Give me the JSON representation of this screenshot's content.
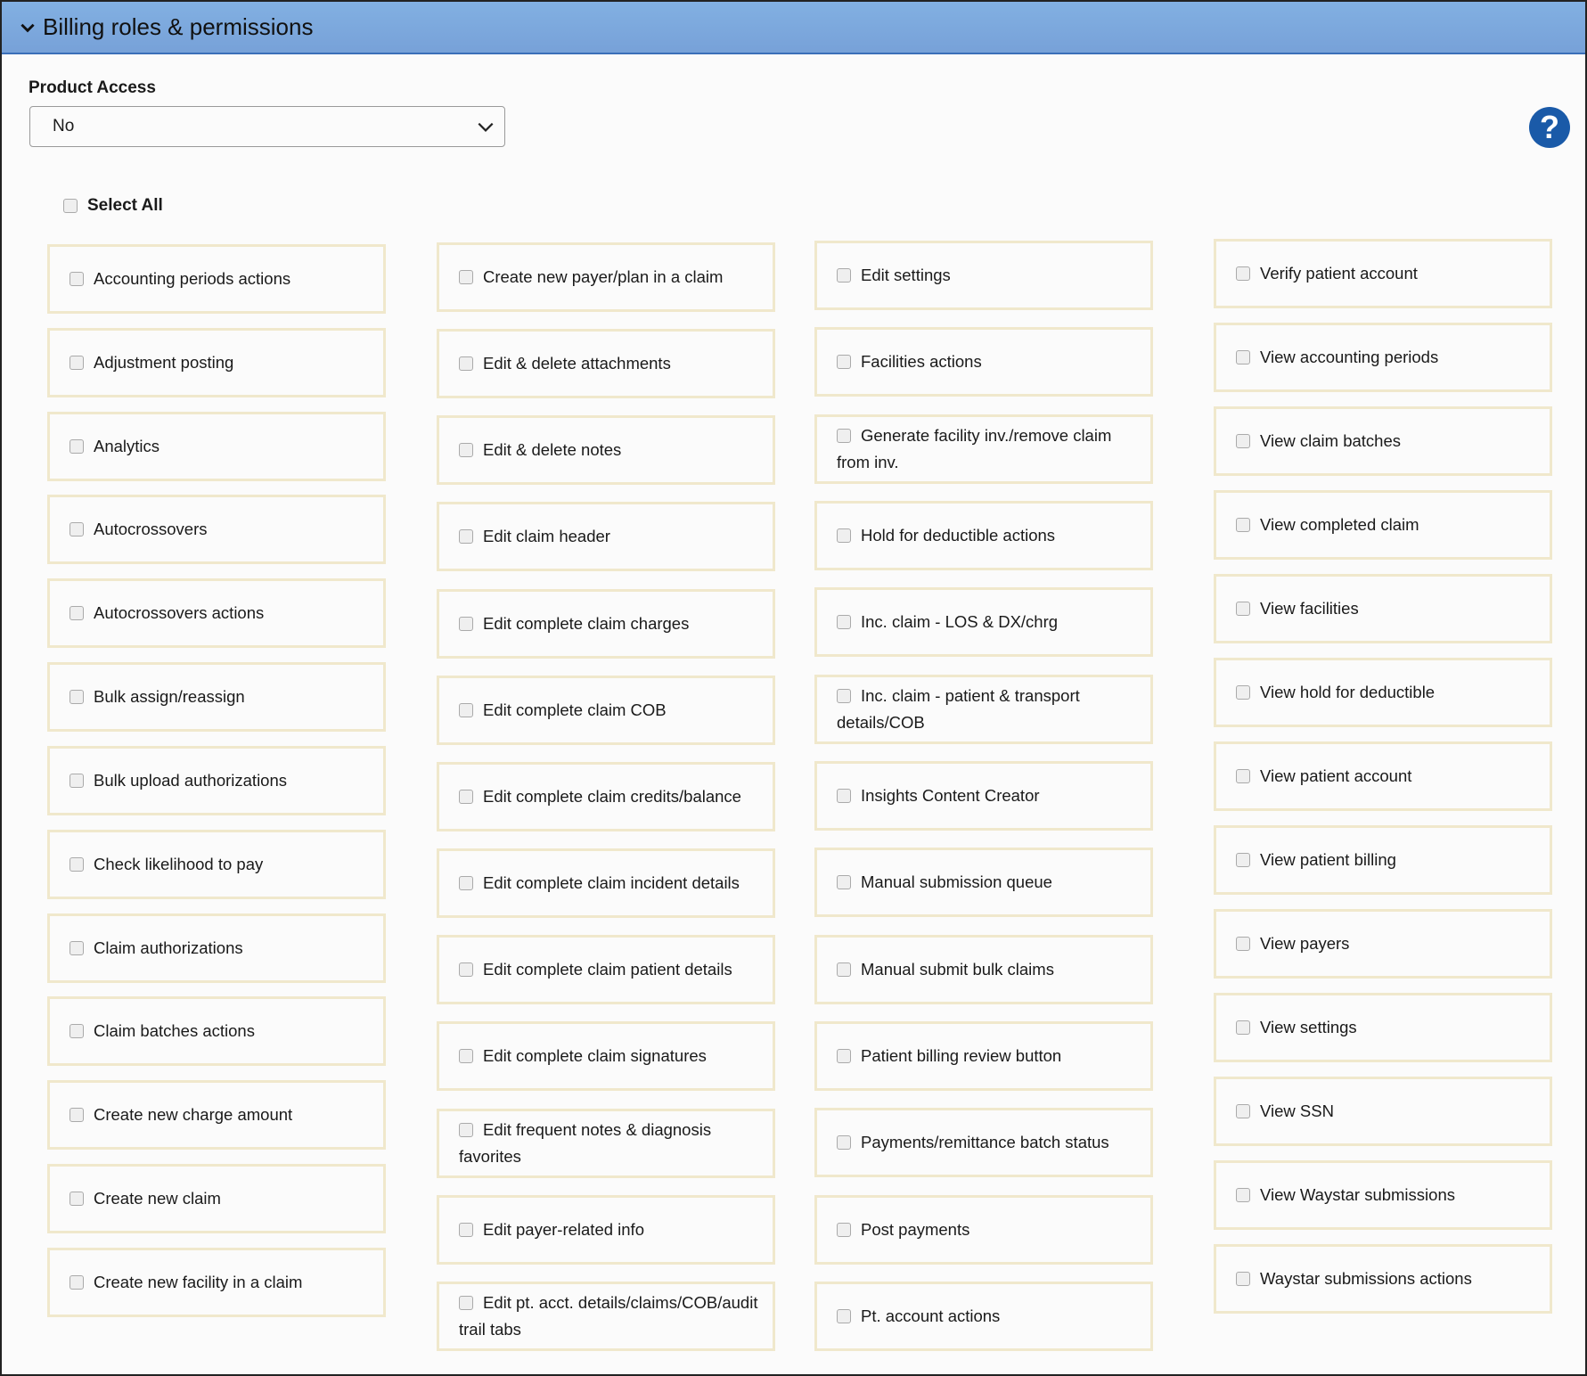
{
  "header": {
    "title": "Billing roles & permissions",
    "collapse_icon": "chevron-down-icon"
  },
  "product_access": {
    "label": "Product Access",
    "value": "No"
  },
  "help_icon": "question-circle-icon",
  "help_color": "#1a5aa8",
  "header_color": "#7fabe0",
  "select_all": {
    "label": "Select All",
    "checked": false
  },
  "columns": [
    [
      "Accounting periods actions",
      "Adjustment posting",
      "Analytics",
      "Autocrossovers",
      "Autocrossovers actions",
      "Bulk assign/reassign",
      "Bulk upload authorizations",
      "Check likelihood to pay",
      "Claim authorizations",
      "Claim batches actions",
      "Create new charge amount",
      "Create new claim",
      "Create new facility in a claim"
    ],
    [
      "Create new payer/plan in a claim",
      "Edit & delete attachments",
      "Edit & delete notes",
      "Edit claim header",
      "Edit complete claim charges",
      "Edit complete claim COB",
      "Edit complete claim credits/balance",
      "Edit complete claim incident details",
      "Edit complete claim patient details",
      "Edit complete claim signatures",
      "Edit frequent notes & diagnosis favorites",
      "Edit payer-related info",
      "Edit pt. acct. details/claims/COB/audit trail tabs"
    ],
    [
      "Edit settings",
      "Facilities actions",
      "Generate facility inv./remove claim from inv.",
      "Hold for deductible actions",
      "Inc. claim - LOS & DX/chrg",
      "Inc. claim - patient & transport details/COB",
      "Insights Content Creator",
      "Manual submission queue",
      "Manual submit bulk claims",
      "Patient billing review button",
      "Payments/remittance batch status",
      "Post payments",
      "Pt. account actions"
    ],
    [
      "Verify patient account",
      "View accounting periods",
      "View claim batches",
      "View completed claim",
      "View facilities",
      "View hold for deductible",
      "View patient account",
      "View patient billing",
      "View payers",
      "View settings",
      "View SSN",
      "View Waystar submissions",
      "Waystar submissions actions"
    ]
  ]
}
